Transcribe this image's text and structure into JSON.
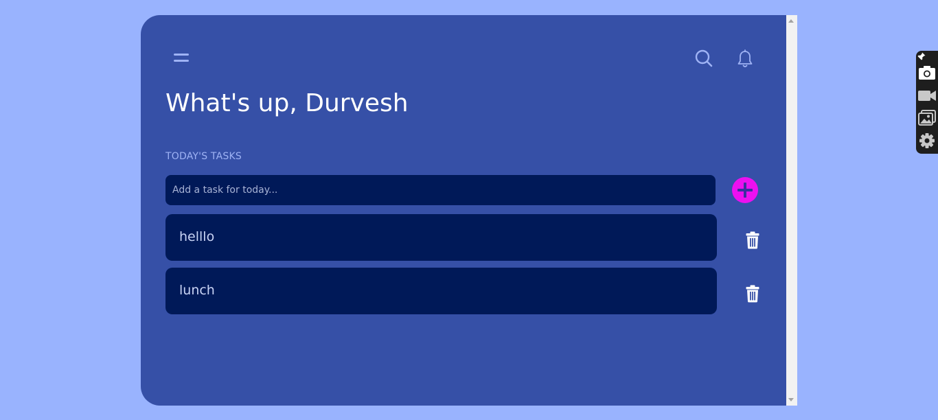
{
  "header": {
    "greeting": "What's up, Durvesh"
  },
  "tasks": {
    "section_label": "TODAY'S TASKS",
    "input_placeholder": "Add a task for today...",
    "input_value": "",
    "items": [
      {
        "text": "helllo"
      },
      {
        "text": "lunch"
      }
    ]
  },
  "icons": {
    "menu": "menu-icon",
    "search": "search-icon",
    "bell": "bell-icon",
    "add": "plus-icon",
    "delete": "trash-icon"
  },
  "extension_toolbar": {
    "buttons": [
      "pin-icon",
      "camera-icon",
      "video-icon",
      "gallery-icon",
      "settings-icon"
    ]
  },
  "colors": {
    "page_background": "#99b3fe",
    "app_background": "#3650a7",
    "card_background": "#001958",
    "accent": "#ec10f0",
    "muted_text": "#9fb3f5"
  }
}
